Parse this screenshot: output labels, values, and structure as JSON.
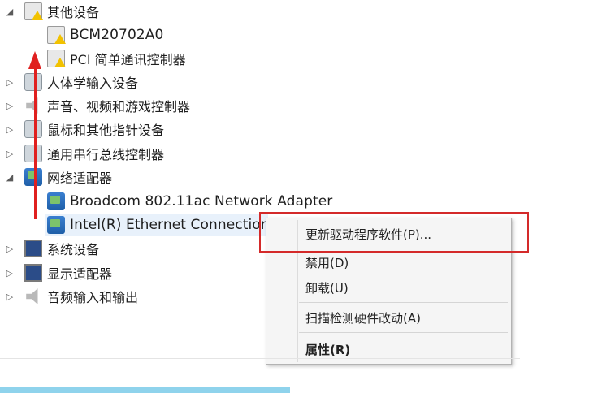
{
  "tree": {
    "other_devices": "其他设备",
    "bcm": "BCM20702A0",
    "pci": "PCI 简单通讯控制器",
    "hid": "人体学输入设备",
    "sound": "声音、视频和游戏控制器",
    "mouse": "鼠标和其他指针设备",
    "usb": "通用串行总线控制器",
    "network": "网络适配器",
    "broadcom": "Broadcom 802.11ac Network Adapter",
    "intel": "Intel(R) Ethernet Connection",
    "system": "系统设备",
    "display": "显示适配器",
    "audio": "音频输入和输出"
  },
  "menu": {
    "update": "更新驱动程序软件(P)...",
    "disable": "禁用(D)",
    "uninstall": "卸载(U)",
    "scan": "扫描检测硬件改动(A)",
    "properties": "属性(R)"
  },
  "colors": {
    "annotation": "#d42a2a",
    "arrow": "#e0201f",
    "statusbar": "#8fd3ec"
  }
}
